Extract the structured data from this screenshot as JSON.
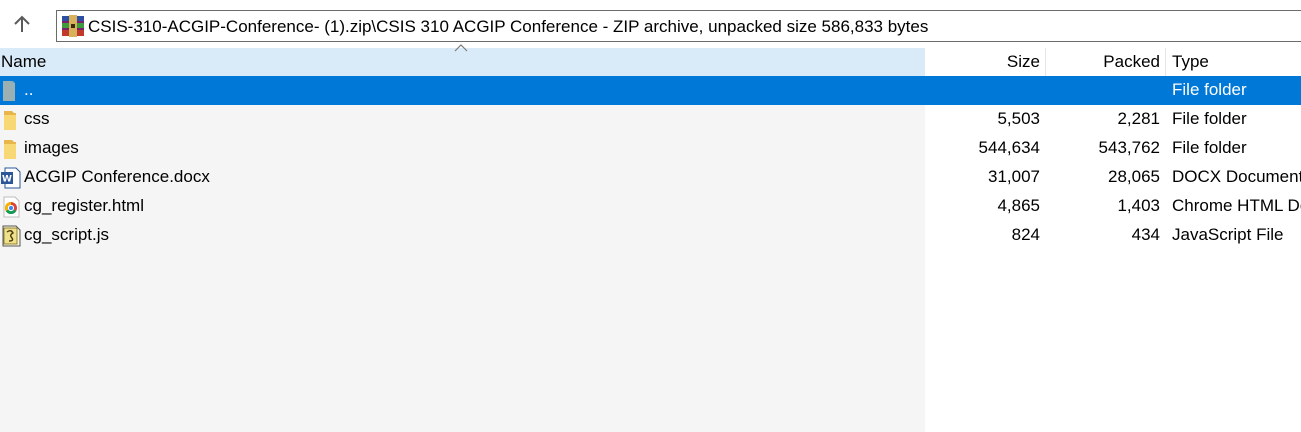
{
  "toolbar": {
    "up_icon": "arrow-up-icon",
    "archive_icon": "winrar-icon",
    "address_path": "CSIS-310-ACGIP-Conference- (1).zip\\CSIS 310 ACGIP Conference  - ZIP archive, unpacked size 586,833 bytes"
  },
  "columns": {
    "name": "Name",
    "size": "Size",
    "packed": "Packed",
    "type": "Type"
  },
  "rows": [
    {
      "name": "..",
      "size": "",
      "packed": "",
      "type": "File folder",
      "icon": "parent-folder-icon",
      "selected": true
    },
    {
      "name": "css",
      "size": "5,503",
      "packed": "2,281",
      "type": "File folder",
      "icon": "folder-icon"
    },
    {
      "name": "images",
      "size": "544,634",
      "packed": "543,762",
      "type": "File folder",
      "icon": "folder-icon"
    },
    {
      "name": "ACGIP Conference.docx",
      "size": "31,007",
      "packed": "28,065",
      "type": "DOCX Document",
      "icon": "word-document-icon"
    },
    {
      "name": "cg_register.html",
      "size": "4,865",
      "packed": "1,403",
      "type": "Chrome HTML Document",
      "icon": "chrome-html-icon"
    },
    {
      "name": "cg_script.js",
      "size": "824",
      "packed": "434",
      "type": "JavaScript File",
      "icon": "javascript-file-icon"
    }
  ],
  "colors": {
    "selection": "#0078d7",
    "header_sorted": "#d9ebf9",
    "folder": "#f8d775"
  }
}
